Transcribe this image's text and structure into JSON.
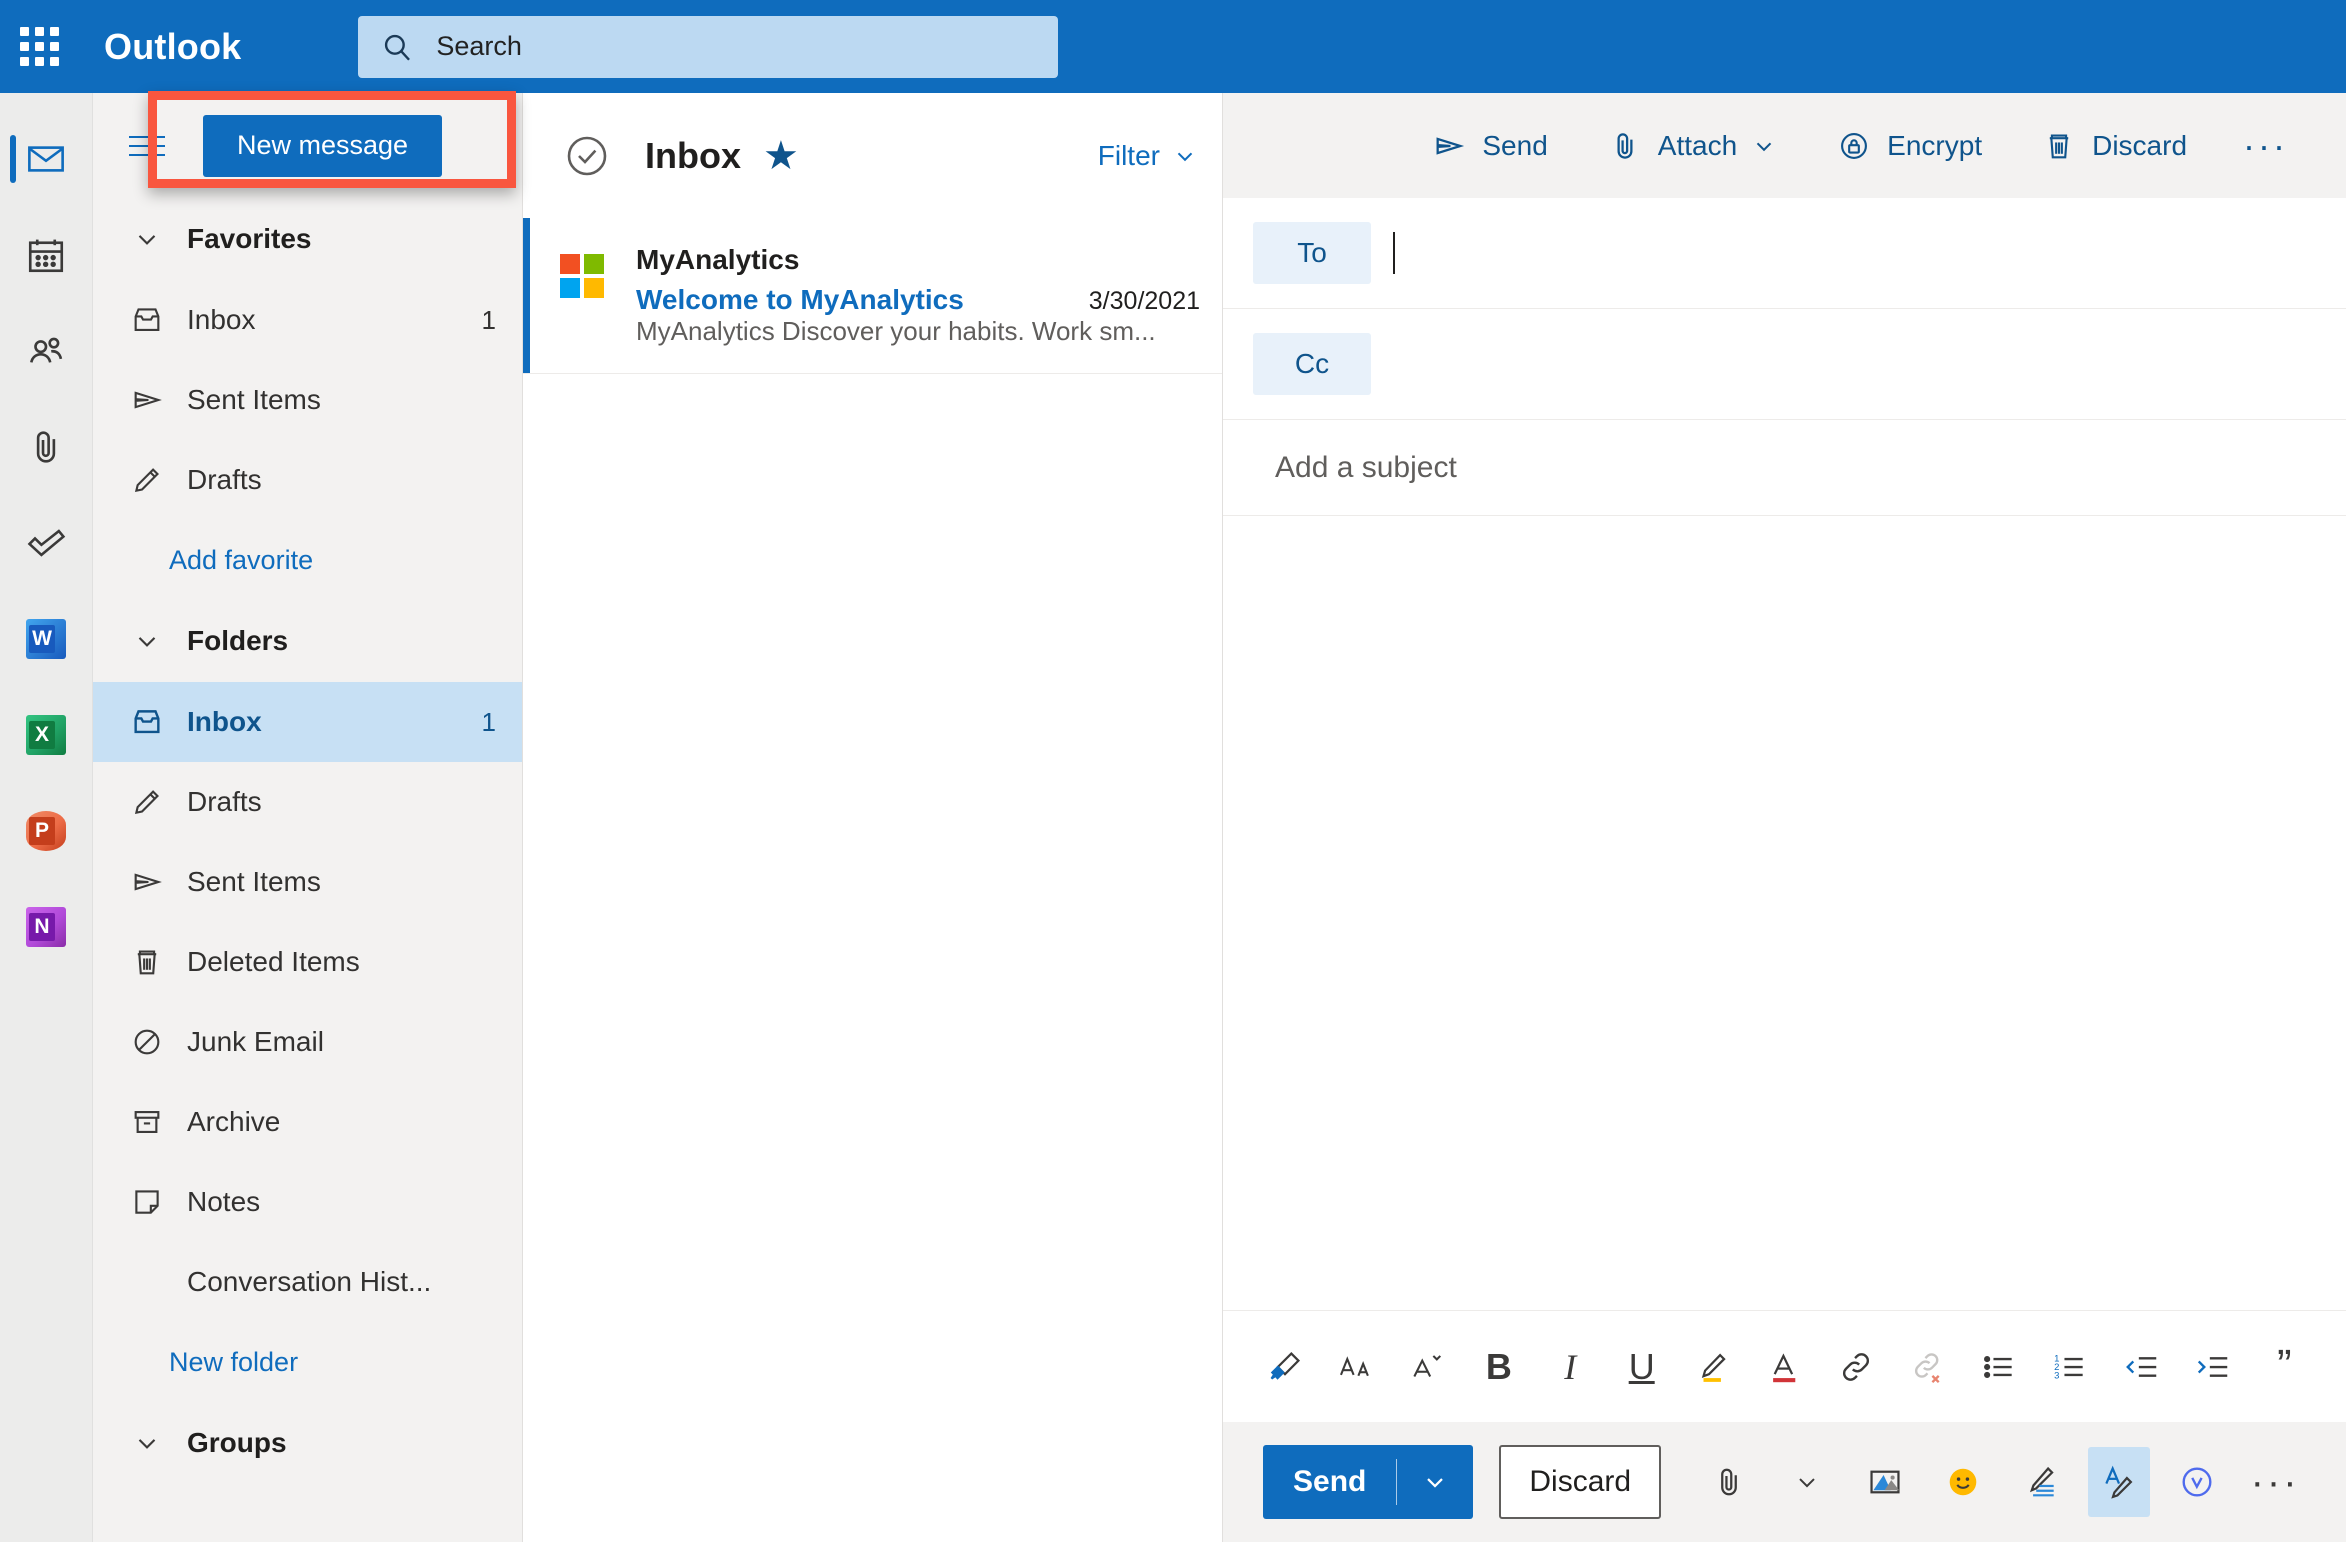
{
  "topbar": {
    "waffle_icon": "app-launcher-icon",
    "brand": "Outlook",
    "search": {
      "icon": "search-icon",
      "placeholder": "Search",
      "value": ""
    }
  },
  "rail": {
    "items": [
      {
        "name": "mail",
        "icon": "mail-icon",
        "active": true
      },
      {
        "name": "calendar",
        "icon": "calendar-icon",
        "active": false
      },
      {
        "name": "people",
        "icon": "people-icon",
        "active": false
      },
      {
        "name": "files",
        "icon": "paperclip-icon",
        "active": false
      },
      {
        "name": "to-do",
        "icon": "checkmark-icon",
        "active": false
      },
      {
        "name": "word",
        "icon": "word-icon",
        "letter": "W"
      },
      {
        "name": "excel",
        "icon": "excel-icon",
        "letter": "X"
      },
      {
        "name": "powerpoint",
        "icon": "powerpoint-icon",
        "letter": "P"
      },
      {
        "name": "onenote",
        "icon": "onenote-icon",
        "letter": "N"
      }
    ]
  },
  "folder_pane": {
    "hamburger_icon": "hamburger-icon",
    "new_message_label": "New message",
    "favorites": {
      "label": "Favorites",
      "chevron_icon": "chevron-down-icon",
      "items": [
        {
          "label": "Inbox",
          "icon": "inbox-icon",
          "count": "1"
        },
        {
          "label": "Sent Items",
          "icon": "send-icon",
          "count": ""
        },
        {
          "label": "Drafts",
          "icon": "pencil-icon",
          "count": ""
        }
      ],
      "add_link": "Add favorite"
    },
    "folders": {
      "label": "Folders",
      "chevron_icon": "chevron-down-icon",
      "items": [
        {
          "label": "Inbox",
          "icon": "inbox-icon",
          "count": "1",
          "selected": true
        },
        {
          "label": "Drafts",
          "icon": "pencil-icon",
          "count": ""
        },
        {
          "label": "Sent Items",
          "icon": "send-icon",
          "count": ""
        },
        {
          "label": "Deleted Items",
          "icon": "trash-icon",
          "count": ""
        },
        {
          "label": "Junk Email",
          "icon": "block-icon",
          "count": ""
        },
        {
          "label": "Archive",
          "icon": "archive-icon",
          "count": ""
        },
        {
          "label": "Notes",
          "icon": "note-icon",
          "count": ""
        },
        {
          "label": "Conversation Hist...",
          "icon": "",
          "count": ""
        }
      ],
      "new_folder_link": "New folder"
    },
    "groups": {
      "label": "Groups",
      "chevron_icon": "chevron-down-icon"
    }
  },
  "message_list": {
    "select_all_icon": "circle-check-icon",
    "title": "Inbox",
    "star_icon": "star-icon",
    "filter_label": "Filter",
    "filter_chevron_icon": "chevron-down-icon",
    "messages": [
      {
        "avatar_icon": "microsoft-logo-icon",
        "sender": "MyAnalytics",
        "subject": "Welcome to MyAnalytics",
        "date": "3/30/2021",
        "preview": "MyAnalytics Discover your habits. Work sm...",
        "unread": true
      }
    ]
  },
  "compose": {
    "toolbar": [
      {
        "label": "Send",
        "icon": "send-icon",
        "chevron": false
      },
      {
        "label": "Attach",
        "icon": "paperclip-icon",
        "chevron": true
      },
      {
        "label": "Encrypt",
        "icon": "lock-icon",
        "chevron": false
      },
      {
        "label": "Discard",
        "icon": "trash-icon",
        "chevron": false
      }
    ],
    "overflow_icon": "more-horizontal-icon",
    "overflow_label": "···",
    "to_label": "To",
    "to_value": "",
    "cc_label": "Cc",
    "cc_value": "",
    "subject_placeholder": "Add a subject",
    "subject_value": "",
    "body_value": "",
    "format_toolbar": [
      {
        "name": "format-painter-icon",
        "glyph": ""
      },
      {
        "name": "font-size-icon",
        "glyph": ""
      },
      {
        "name": "font-options-icon",
        "glyph": ""
      },
      {
        "name": "bold-icon",
        "glyph": "B"
      },
      {
        "name": "italic-icon",
        "glyph": "I"
      },
      {
        "name": "underline-icon",
        "glyph": "U"
      },
      {
        "name": "highlight-icon",
        "glyph": ""
      },
      {
        "name": "font-color-icon",
        "glyph": "A"
      },
      {
        "name": "insert-link-icon",
        "glyph": ""
      },
      {
        "name": "remove-link-icon",
        "glyph": ""
      },
      {
        "name": "bulleted-list-icon",
        "glyph": ""
      },
      {
        "name": "numbered-list-icon",
        "glyph": ""
      },
      {
        "name": "decrease-indent-icon",
        "glyph": ""
      },
      {
        "name": "increase-indent-icon",
        "glyph": ""
      },
      {
        "name": "quote-icon",
        "glyph": "”"
      }
    ],
    "action_bar": {
      "send_label": "Send",
      "send_chevron_icon": "chevron-down-icon",
      "discard_label": "Discard",
      "buttons": [
        {
          "name": "attach-file-icon",
          "active": false
        },
        {
          "name": "attach-chevron-icon",
          "active": false
        },
        {
          "name": "insert-picture-icon",
          "active": false
        },
        {
          "name": "emoji-icon",
          "active": false
        },
        {
          "name": "signature-icon",
          "active": false
        },
        {
          "name": "editor-icon",
          "active": true
        },
        {
          "name": "viva-insights-icon",
          "active": false
        },
        {
          "name": "more-options-icon",
          "active": false
        }
      ],
      "more_label": "···"
    }
  },
  "colors": {
    "brand_blue": "#0f6cbd",
    "highlight_red": "#f9563f",
    "selected_row": "#c7e0f4",
    "link_blue": "#0f548c"
  }
}
